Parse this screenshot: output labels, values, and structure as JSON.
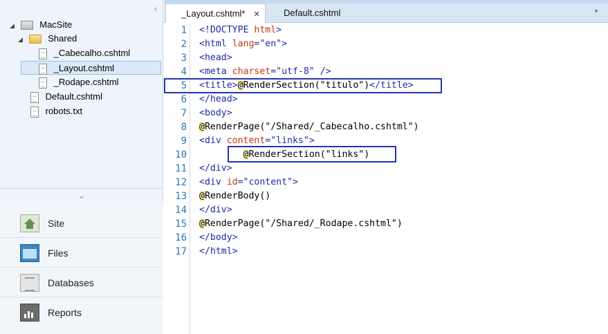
{
  "tree": {
    "collapse_glyph": "‹",
    "items": [
      {
        "label": "MacSite",
        "icon": "site-icon",
        "expander": "◢"
      },
      {
        "label": "Shared",
        "icon": "folder-icon",
        "expander": "◢"
      },
      {
        "label": "_Cabecalho.cshtml",
        "icon": "file-icon"
      },
      {
        "label": "_Layout.cshtml",
        "icon": "file-icon",
        "selected": true
      },
      {
        "label": "_Rodape.cshtml",
        "icon": "file-icon"
      },
      {
        "label": "Default.cshtml",
        "icon": "file-icon"
      },
      {
        "label": "robots.txt",
        "icon": "file-icon"
      }
    ]
  },
  "nav": {
    "grip_glyph": "⌄",
    "items": [
      {
        "label": "Site",
        "icon": "site-nav-icon"
      },
      {
        "label": "Files",
        "icon": "files-nav-icon"
      },
      {
        "label": "Databases",
        "icon": "databases-nav-icon"
      },
      {
        "label": "Reports",
        "icon": "reports-nav-icon"
      }
    ]
  },
  "tabs": {
    "items": [
      {
        "label": "_Layout.cshtml*",
        "active": true,
        "close": "✕"
      },
      {
        "label": "Default.cshtml",
        "active": false
      }
    ],
    "dropdown_glyph": "▾"
  },
  "editor": {
    "lines": [
      {
        "n": "1",
        "tokens": [
          [
            "tag",
            "<!DOCTYPE "
          ],
          [
            "attr",
            "html"
          ],
          [
            "tag",
            ">"
          ]
        ]
      },
      {
        "n": "2",
        "tokens": [
          [
            "tag",
            "<html "
          ],
          [
            "attr",
            "lang"
          ],
          [
            "tag",
            "="
          ],
          [
            "str",
            "\"en\""
          ],
          [
            "tag",
            ">"
          ]
        ]
      },
      {
        "n": "3",
        "tokens": [
          [
            "tag",
            "<head>"
          ]
        ]
      },
      {
        "n": "4",
        "tokens": [
          [
            "tag",
            "<meta "
          ],
          [
            "attr",
            "charset"
          ],
          [
            "tag",
            "="
          ],
          [
            "str",
            "\"utf-8\""
          ],
          [
            "tag",
            " />"
          ]
        ]
      },
      {
        "n": "5",
        "tokens": [
          [
            "tag",
            "<title>"
          ],
          [
            "razor",
            "@"
          ],
          [
            "plain",
            "RenderSection(\"titulo\")"
          ],
          [
            "tag",
            "</title>"
          ]
        ]
      },
      {
        "n": "6",
        "tokens": [
          [
            "tag",
            "</head>"
          ]
        ]
      },
      {
        "n": "7",
        "tokens": [
          [
            "tag",
            "<body>"
          ]
        ]
      },
      {
        "n": "8",
        "tokens": [
          [
            "razor",
            "@"
          ],
          [
            "plain",
            "RenderPage(\"/Shared/_Cabecalho.cshtml\")"
          ]
        ]
      },
      {
        "n": "9",
        "tokens": [
          [
            "tag",
            "<div "
          ],
          [
            "attr",
            "content"
          ],
          [
            "tag",
            "="
          ],
          [
            "str",
            "\"links\""
          ],
          [
            "tag",
            ">"
          ]
        ]
      },
      {
        "n": "10",
        "tokens": [
          [
            "plain",
            "        "
          ],
          [
            "razor",
            "@"
          ],
          [
            "plain",
            "RenderSection(\"links\")"
          ]
        ]
      },
      {
        "n": "11",
        "tokens": [
          [
            "tag",
            "</div>"
          ]
        ]
      },
      {
        "n": "12",
        "tokens": [
          [
            "tag",
            "<div "
          ],
          [
            "attr",
            "id"
          ],
          [
            "tag",
            "="
          ],
          [
            "str",
            "\"content\""
          ],
          [
            "tag",
            ">"
          ]
        ]
      },
      {
        "n": "13",
        "tokens": [
          [
            "razor",
            "@"
          ],
          [
            "plain",
            "RenderBody()"
          ]
        ]
      },
      {
        "n": "14",
        "tokens": [
          [
            "tag",
            "</div>"
          ]
        ]
      },
      {
        "n": "15",
        "tokens": [
          [
            "razor",
            "@"
          ],
          [
            "plain",
            "RenderPage(\"/Shared/_Rodape.cshtml\")"
          ]
        ]
      },
      {
        "n": "16",
        "tokens": [
          [
            "tag",
            "</body>"
          ]
        ]
      },
      {
        "n": "17",
        "tokens": [
          [
            "tag",
            "</html>"
          ]
        ]
      }
    ]
  },
  "colors": {
    "tag": "#1e2aa8",
    "attribute": "#c5380f",
    "razor_highlight": "#fbed9f",
    "line_number": "#2b78b8",
    "annotation_box": "#2434b0"
  }
}
